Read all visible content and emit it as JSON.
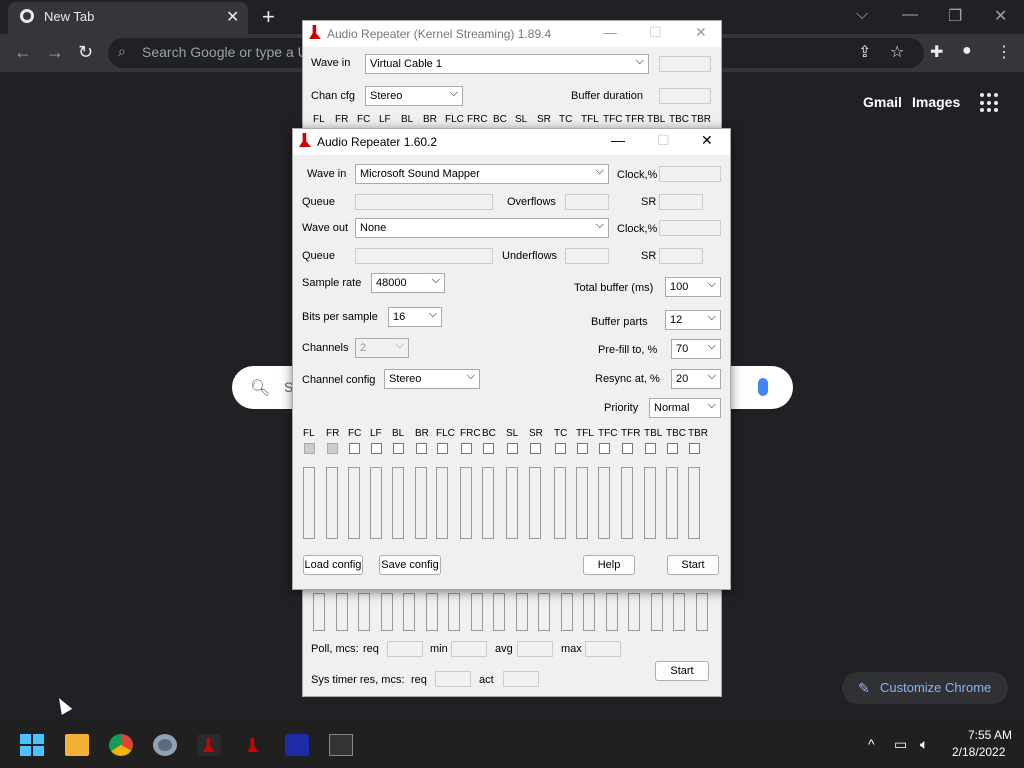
{
  "browser": {
    "tab_title": "New Tab",
    "omnibox_placeholder": "Search Google or type a URL",
    "gmail": "Gmail",
    "images": "Images",
    "search_placeholder": "S",
    "customize": "Customize Chrome"
  },
  "ks_window": {
    "title": "Audio Repeater (Kernel Streaming) 1.89.4",
    "wave_in_label": "Wave in",
    "wave_in_value": "Virtual Cable 1",
    "chan_cfg_label": "Chan cfg",
    "chan_cfg_value": "Stereo",
    "buffer_duration_label": "Buffer duration",
    "channels": [
      "FL",
      "FR",
      "FC",
      "LF",
      "BL",
      "BR",
      "FLC",
      "FRC",
      "BC",
      "SL",
      "SR",
      "TC",
      "TFL",
      "TFC",
      "TFR",
      "TBL",
      "TBC",
      "TBR"
    ],
    "poll_label": "Poll, mcs:",
    "req": "req",
    "min": "min",
    "avg": "avg",
    "max": "max",
    "systimer_label": "Sys timer res, mcs:",
    "act": "act",
    "start": "Start"
  },
  "ar_window": {
    "title": "Audio Repeater 1.60.2",
    "wave_in_label": "Wave in",
    "wave_in_value": "Microsoft Sound Mapper",
    "clock_label": "Clock,%",
    "queue_label": "Queue",
    "overflows_label": "Overflows",
    "sr_label": "SR",
    "wave_out_label": "Wave out",
    "wave_out_value": "None",
    "underflows_label": "Underflows",
    "sample_rate_label": "Sample rate",
    "sample_rate_value": "48000",
    "bits_label": "Bits per sample",
    "bits_value": "16",
    "channels_label": "Channels",
    "channels_value": "2",
    "chconfig_label": "Channel config",
    "chconfig_value": "Stereo",
    "total_buffer_label": "Total buffer (ms)",
    "total_buffer_value": "100",
    "buffer_parts_label": "Buffer parts",
    "buffer_parts_value": "12",
    "prefill_label": "Pre-fill to, %",
    "prefill_value": "70",
    "resync_label": "Resync at, %",
    "resync_value": "20",
    "priority_label": "Priority",
    "priority_value": "Normal",
    "channels": [
      "FL",
      "FR",
      "FC",
      "LF",
      "BL",
      "BR",
      "FLC",
      "FRC",
      "BC",
      "SL",
      "SR",
      "TC",
      "TFL",
      "TFC",
      "TFR",
      "TBL",
      "TBC",
      "TBR"
    ],
    "load_config": "Load config",
    "save_config": "Save config",
    "help": "Help",
    "start": "Start"
  },
  "taskbar": {
    "time": "7:55 AM",
    "date": "2/18/2022"
  }
}
